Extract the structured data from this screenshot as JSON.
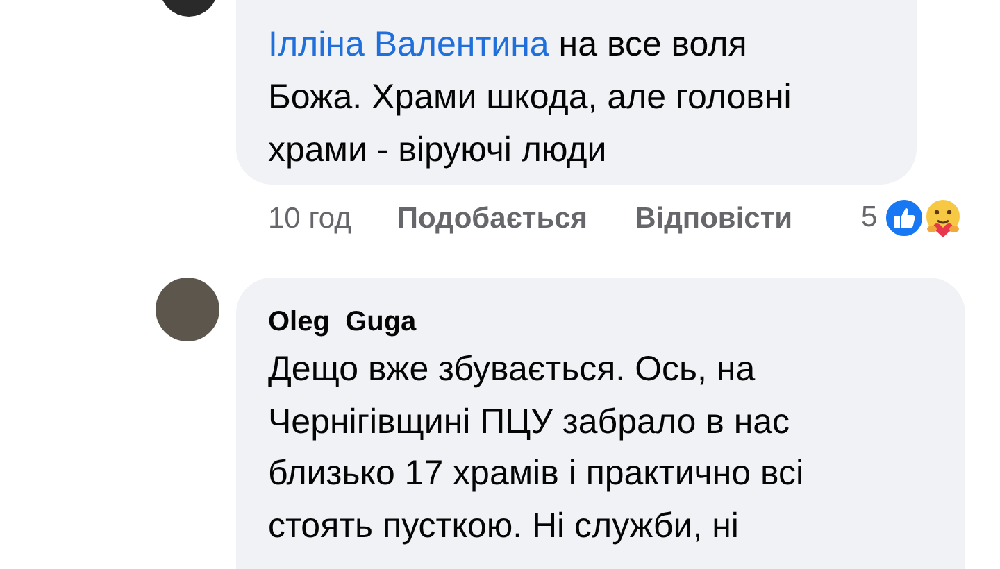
{
  "comments": [
    {
      "mention": "Ілліна Валентина",
      "text": "на все воля Божа. Храми шкода, але головні храми - віруючі люди",
      "time": "10 год",
      "like_label": "Подобається",
      "reply_label": "Відповісти",
      "reaction_count": "5"
    },
    {
      "author": "Oleg  Guga",
      "text": "Дещо вже збувається. Ось, на Чернігівщині ПЦУ забрало в нас близько 17 храмів і практично всі стоять пусткою. Ні служби, ні"
    }
  ]
}
